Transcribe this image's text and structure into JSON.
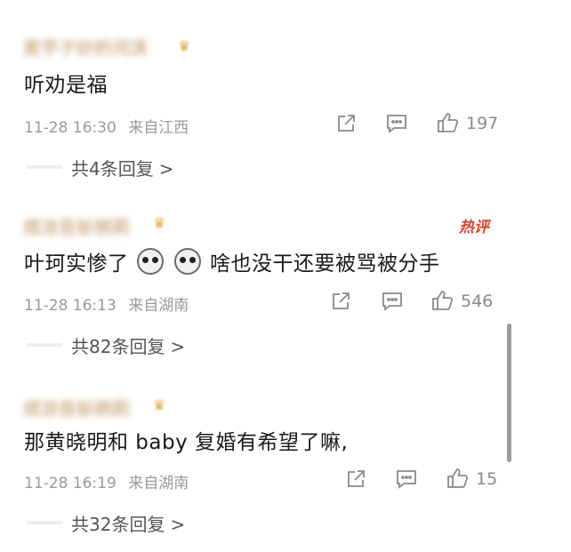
{
  "comments": [
    {
      "username": "麦芋子妙的河淇",
      "hot_label": "",
      "text_parts": [
        "听劝是福"
      ],
      "time": "11-28 16:30",
      "location": "来自江西",
      "likes": "197",
      "replies": "共4条回复",
      "chevron": ">"
    },
    {
      "username": "烦凉吾斩柄莉",
      "hot_label": "热评",
      "text_parts": [
        "叶珂实惨了",
        "啥也没干还要被骂被分手"
      ],
      "time": "11-28 16:13",
      "location": "来自湖南",
      "likes": "546",
      "replies": "共82条回复",
      "chevron": ">"
    },
    {
      "username": "烦凉吾斩柄莉",
      "hot_label": "",
      "text_parts": [
        "那黄晓明和 baby 复婚有希望了嘛,"
      ],
      "time": "11-28 16:19",
      "location": "来自湖南",
      "likes": "15",
      "replies": "共32条回复",
      "chevron": ">"
    }
  ],
  "icons": {
    "share": "share-icon",
    "comment": "comment-icon",
    "like": "thumbs-up-icon",
    "emoji": "dog-face-emoji-icon"
  },
  "colors": {
    "hot": "#d6452f",
    "meta": "#9a9a9a",
    "text": "#1a1a1a"
  }
}
